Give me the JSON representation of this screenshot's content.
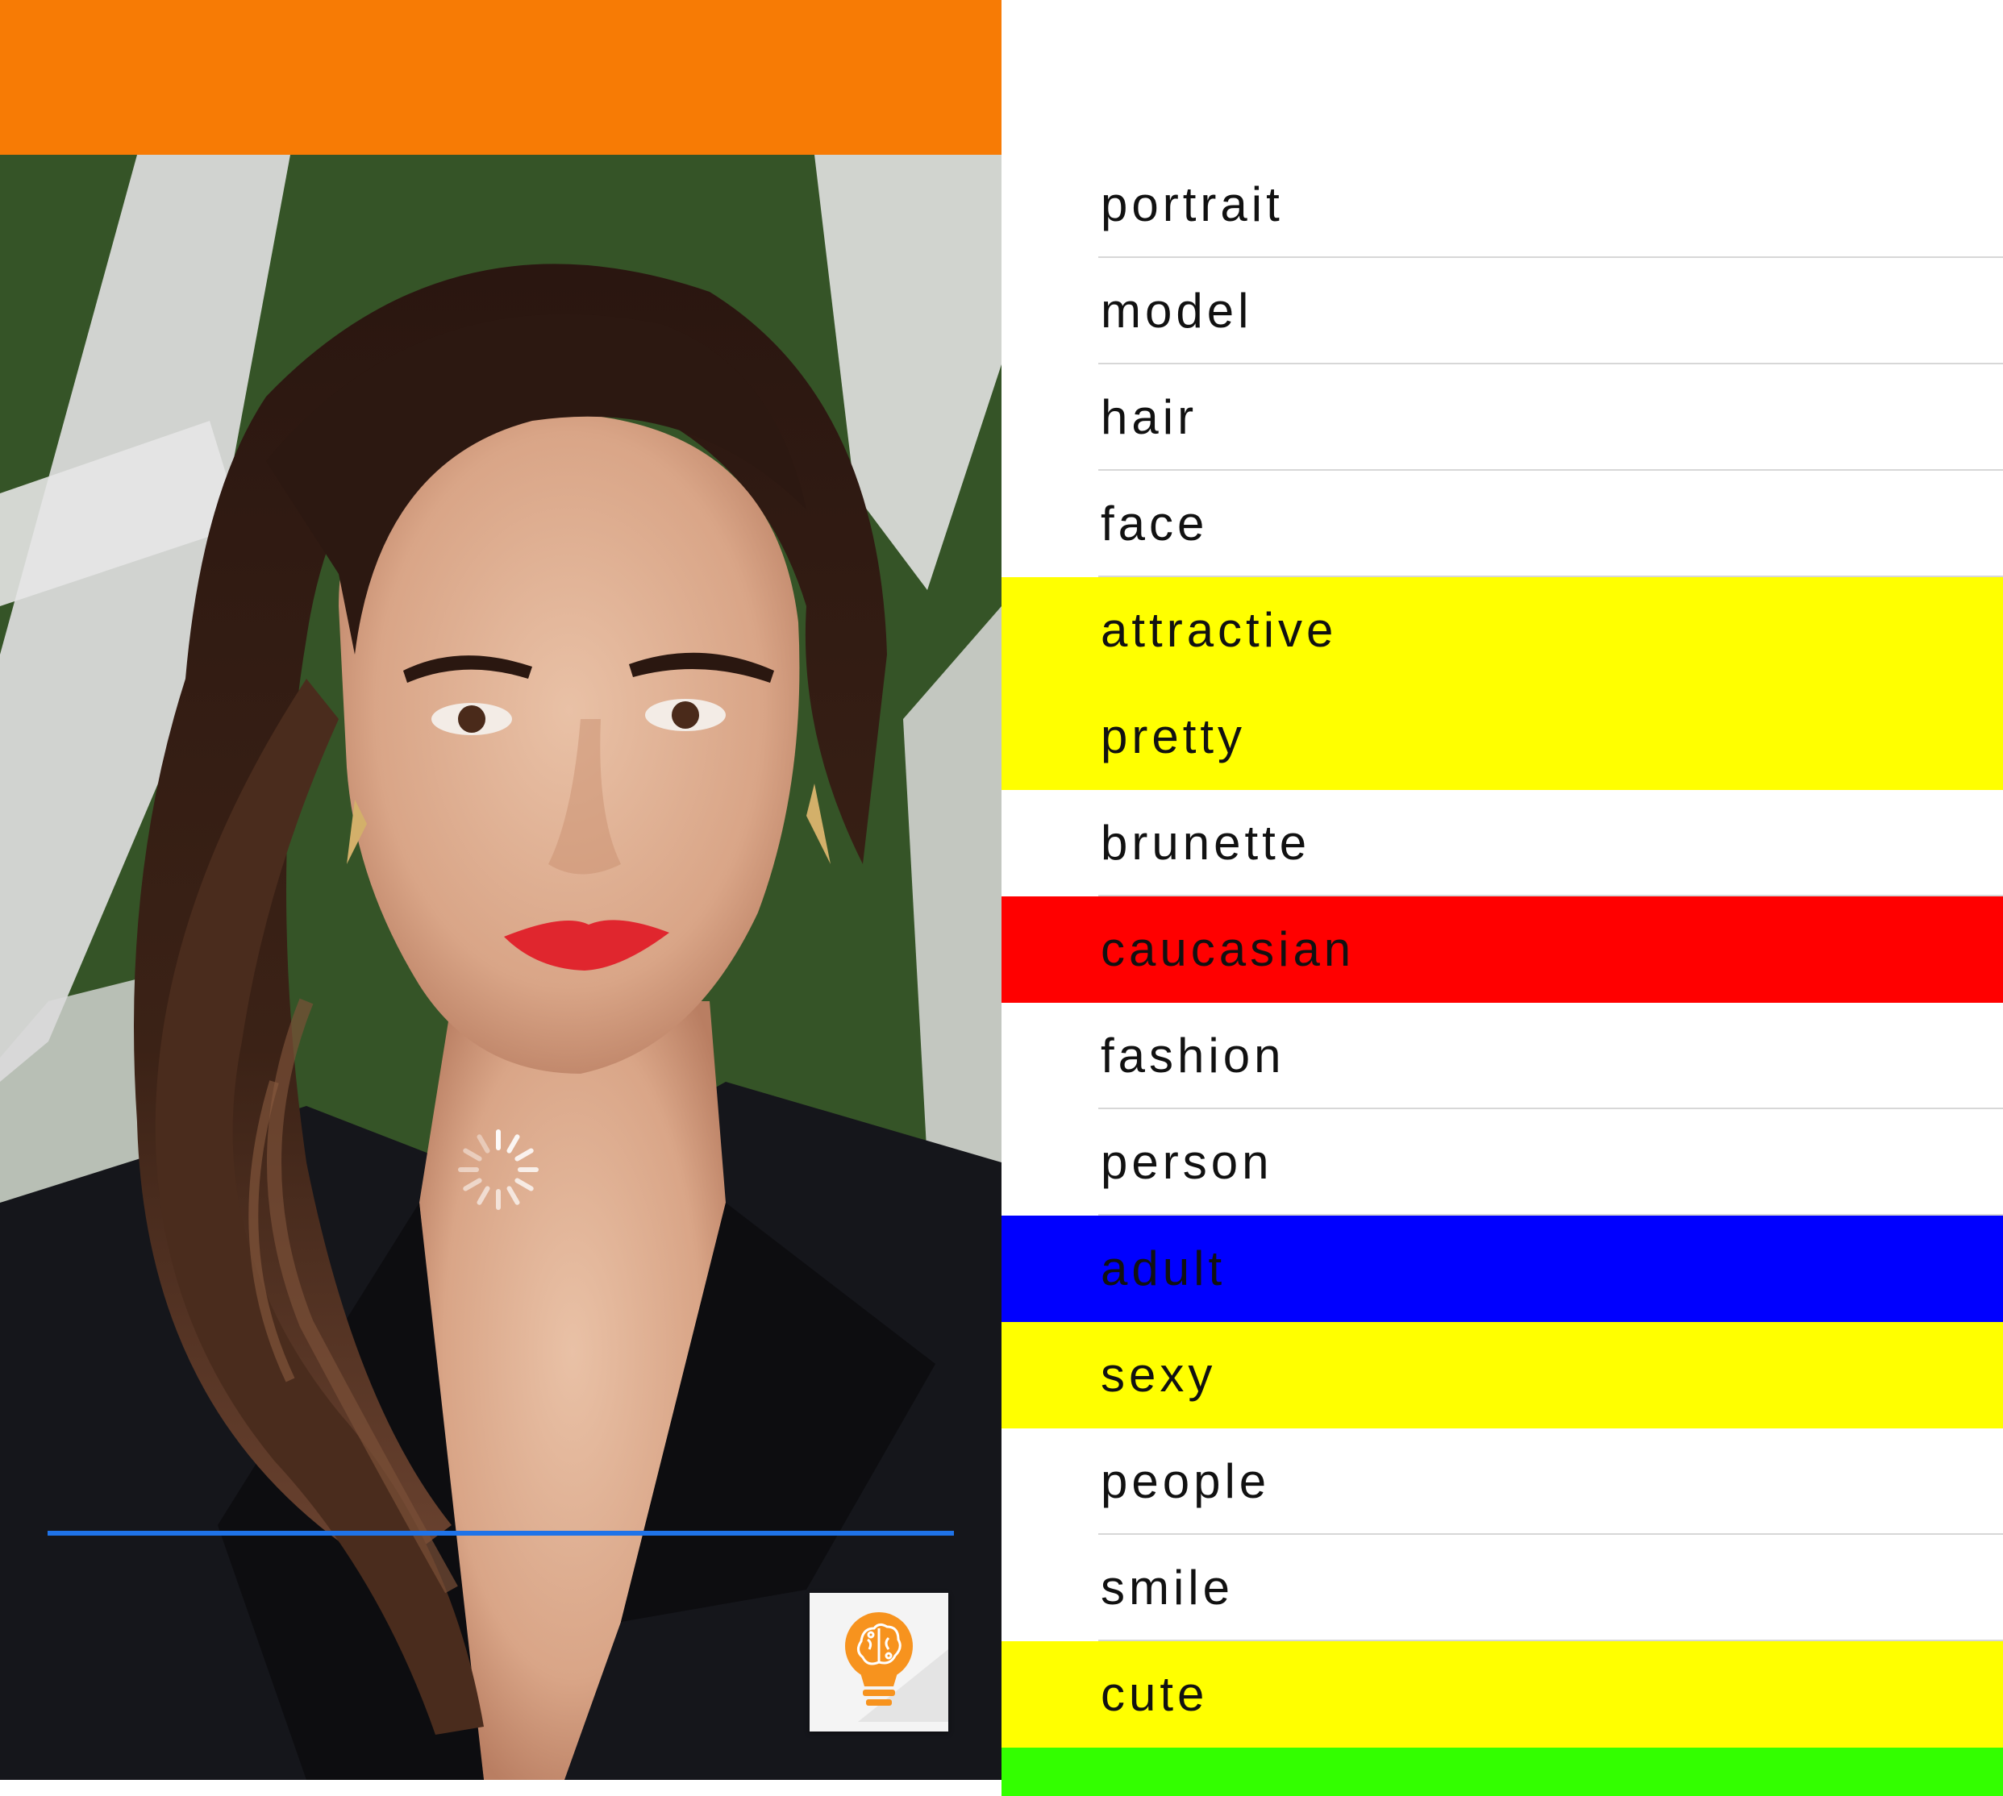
{
  "colors": {
    "top_bar": "#F77B05",
    "progress_line": "#1F73E8",
    "app_icon": "#F7931E"
  },
  "photo": {
    "spinner_icon": "loading-spinner",
    "app_icon": "lightbulb-brain-icon"
  },
  "tags": [
    {
      "label": "portrait",
      "color": "#ffffff"
    },
    {
      "label": "model",
      "color": "#ffffff"
    },
    {
      "label": "hair",
      "color": "#ffffff"
    },
    {
      "label": "face",
      "color": "#ffffff"
    },
    {
      "label": "attractive",
      "color": "#FFFF00"
    },
    {
      "label": "pretty",
      "color": "#FFFF00"
    },
    {
      "label": "brunette",
      "color": "#ffffff"
    },
    {
      "label": "caucasian",
      "color": "#FF0000"
    },
    {
      "label": "fashion",
      "color": "#ffffff"
    },
    {
      "label": "person",
      "color": "#ffffff"
    },
    {
      "label": "adult",
      "color": "#0000FF"
    },
    {
      "label": "sexy",
      "color": "#FFFF00"
    },
    {
      "label": "people",
      "color": "#ffffff"
    },
    {
      "label": "smile",
      "color": "#ffffff"
    },
    {
      "label": "cute",
      "color": "#FFFF00"
    },
    {
      "label": "",
      "color": "#33FF00"
    }
  ]
}
